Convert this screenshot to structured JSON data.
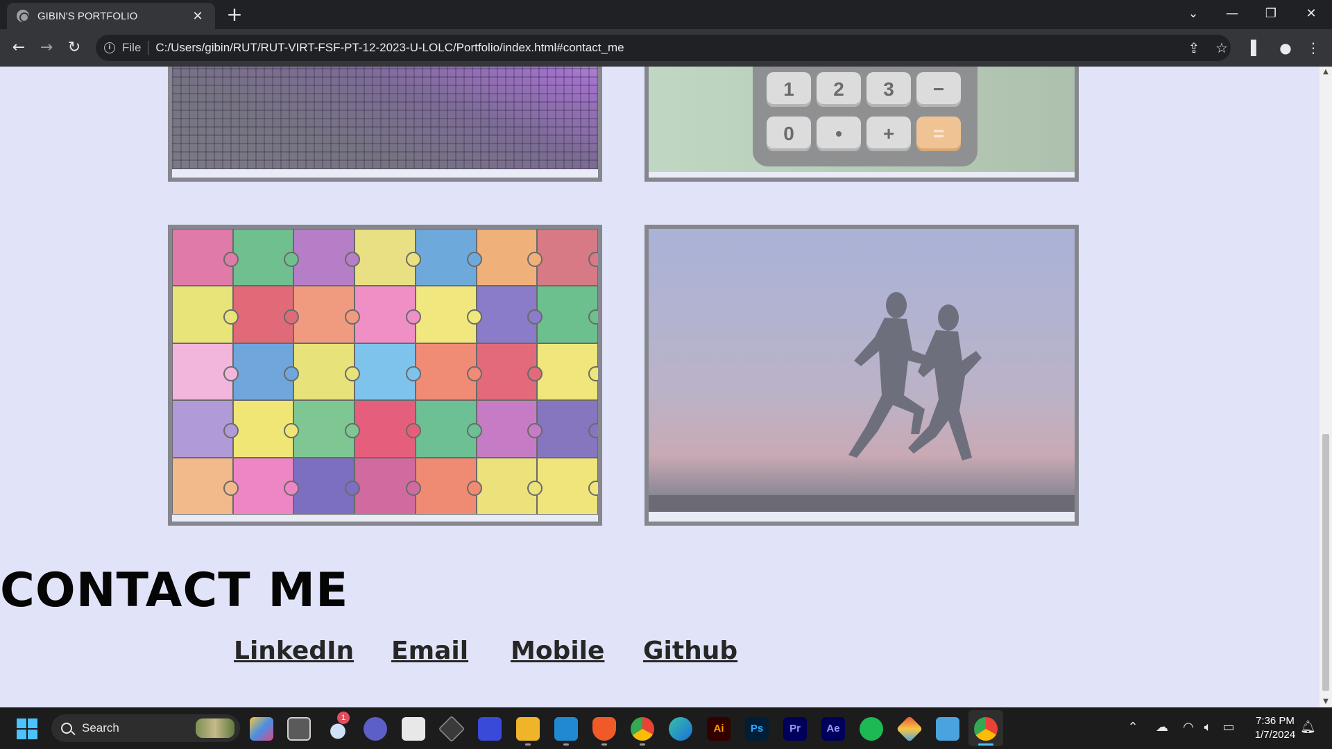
{
  "browser": {
    "tab_title": "GIBIN'S PORTFOLIO",
    "tab_close": "✕",
    "new_tab": "+",
    "url_scheme": "File",
    "url": "C:/Users/gibin/RUT/RUT-VIRT-FSF-PT-12-2023-U-LOLC/Portfolio/index.html#contact_me",
    "back": "←",
    "forward": "→",
    "reload": "↻",
    "win_dropdown": "⌄",
    "win_minimize": "—",
    "win_restore": "❐",
    "win_close": "✕",
    "share_icon": "⇪",
    "star_icon": "☆",
    "sidepanel_icon": "▌",
    "profile_icon": "●",
    "menu_icon": "⋮"
  },
  "calculator_keys": [
    {
      "label": "1"
    },
    {
      "label": "2"
    },
    {
      "label": "3"
    },
    {
      "label": "−"
    },
    {
      "label": "0"
    },
    {
      "label": "•"
    },
    {
      "label": "+"
    },
    {
      "label": "="
    }
  ],
  "contact": {
    "title": "CONTACT ME",
    "links": [
      "LinkedIn",
      "Email",
      "Mobile",
      "Github"
    ]
  },
  "taskbar": {
    "search_label": "Search",
    "notification_badge": "1",
    "app_labels": {
      "illustrator": "Ai",
      "photoshop": "Ps",
      "premiere": "Pr",
      "after_effects": "Ae"
    },
    "time": "7:36 PM",
    "date": "1/7/2024"
  },
  "colors": {
    "page_bg": "#e1e4f8",
    "card_border": "#86878e",
    "title_text": "#050505"
  }
}
